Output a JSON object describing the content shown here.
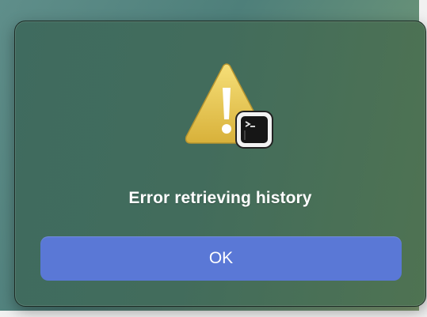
{
  "dialog": {
    "message": "Error retrieving history",
    "ok_label": "OK",
    "icon": "warning-icon",
    "badge_icon": "terminal-app-icon",
    "accent_color": "#5a78d6"
  }
}
